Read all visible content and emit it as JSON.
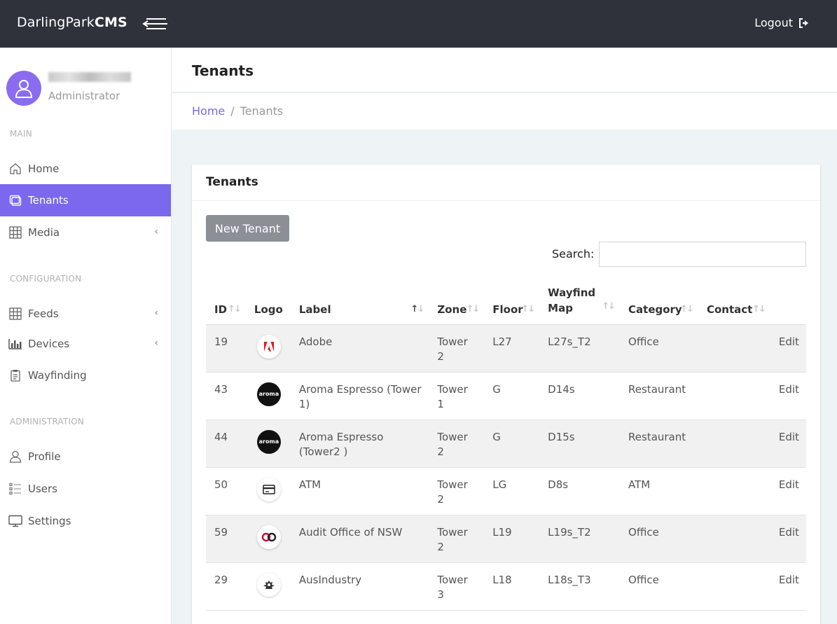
{
  "brand": {
    "name": "DarlingPark",
    "suffix": "CMS"
  },
  "topbar": {
    "logout_label": "Logout"
  },
  "user": {
    "role": "Administrator"
  },
  "sidebar": {
    "sections": {
      "main": "MAIN",
      "configuration": "CONFIGURATION",
      "administration": "ADMINISTRATION"
    },
    "items": {
      "home": "Home",
      "tenants": "Tenants",
      "media": "Media",
      "feeds": "Feeds",
      "devices": "Devices",
      "wayfinding": "Wayfinding",
      "profile": "Profile",
      "users": "Users",
      "settings": "Settings"
    }
  },
  "page": {
    "title": "Tenants",
    "breadcrumb": {
      "home": "Home",
      "separator": "/",
      "current": "Tenants"
    }
  },
  "card": {
    "title": "Tenants",
    "new_button": "New Tenant",
    "search_label": "Search:",
    "search_value": ""
  },
  "table": {
    "columns": {
      "id": "ID",
      "logo": "Logo",
      "label": "Label",
      "zone": "Zone",
      "floor": "Floor",
      "wayfind_1": "Wayfind",
      "wayfind_2": "Map",
      "category": "Category",
      "contact": "Contact"
    },
    "rows": [
      {
        "id": "19",
        "logo": "adobe-logo",
        "label": "Adobe",
        "zone": "Tower 2",
        "floor": "L27",
        "map": "L27s_T2",
        "category": "Office",
        "contact": "",
        "action": "Edit"
      },
      {
        "id": "43",
        "logo": "aroma-logo",
        "logo_text": "aroma",
        "label": "Aroma Espresso (Tower 1)",
        "zone": "Tower 1",
        "floor": "G",
        "map": "D14s",
        "category": "Restaurant",
        "contact": "",
        "action": "Edit"
      },
      {
        "id": "44",
        "logo": "aroma-logo",
        "logo_text": "aroma",
        "label": "Aroma Espresso (Tower2 )",
        "zone": "Tower 2",
        "floor": "G",
        "map": "D15s",
        "category": "Restaurant",
        "contact": "",
        "action": "Edit"
      },
      {
        "id": "50",
        "logo": "atm-card-logo",
        "label": "ATM",
        "zone": "Tower 2",
        "floor": "LG",
        "map": "D8s",
        "category": "ATM",
        "contact": "",
        "action": "Edit"
      },
      {
        "id": "59",
        "logo": "audit-office-logo",
        "label": "Audit Office of NSW",
        "zone": "Tower 2",
        "floor": "L19",
        "map": "L19s_T2",
        "category": "Office",
        "contact": "",
        "action": "Edit"
      },
      {
        "id": "29",
        "logo": "coat-of-arms-logo",
        "label": "AusIndustry",
        "zone": "Tower 3",
        "floor": "L18",
        "map": "L18s_T3",
        "category": "Office",
        "contact": "",
        "action": "Edit"
      }
    ]
  },
  "colors": {
    "accent": "#7b68ee",
    "topbar": "#2f323b",
    "button": "#8a9096"
  }
}
